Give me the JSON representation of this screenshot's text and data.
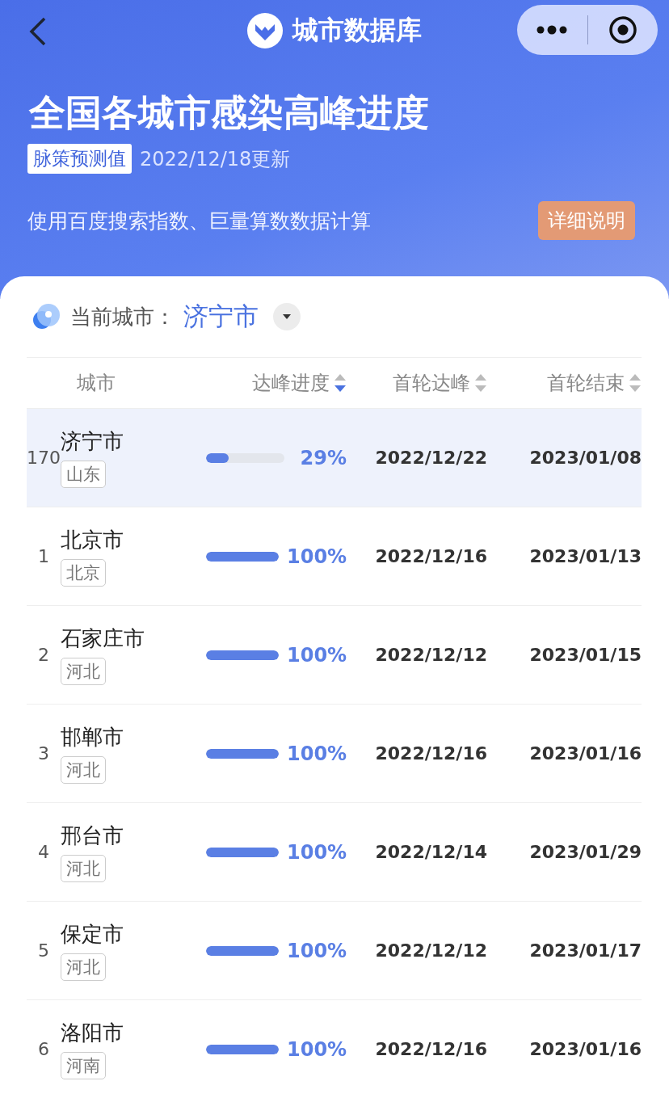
{
  "nav": {
    "title": "城市数据库"
  },
  "header": {
    "title": "全国各城市感染高峰进度",
    "badge": "脉策预测值",
    "updated": "2022/12/18更新",
    "description": "使用百度搜索指数、巨量算数数据计算",
    "detail_button": "详细说明"
  },
  "current_city": {
    "label": "当前城市：",
    "value": "济宁市"
  },
  "table": {
    "columns": [
      {
        "label": "城市",
        "sortable": false
      },
      {
        "label": "达峰进度",
        "sortable": true,
        "sorted_desc": true
      },
      {
        "label": "首轮达峰",
        "sortable": true,
        "sorted_desc": false
      },
      {
        "label": "首轮结束",
        "sortable": true,
        "sorted_desc": false
      }
    ],
    "rows": [
      {
        "rank": "170",
        "city": "济宁市",
        "province": "山东",
        "level": 0.29,
        "percent": "29%",
        "peak": "2022/12/22",
        "end": "2023/01/08",
        "selected": true
      },
      {
        "rank": "1",
        "city": "北京市",
        "province": "北京",
        "level": 1,
        "percent": "100%",
        "peak": "2022/12/16",
        "end": "2023/01/13",
        "selected": false
      },
      {
        "rank": "2",
        "city": "石家庄市",
        "province": "河北",
        "level": 1,
        "percent": "100%",
        "peak": "2022/12/12",
        "end": "2023/01/15",
        "selected": false
      },
      {
        "rank": "3",
        "city": "邯郸市",
        "province": "河北",
        "level": 1,
        "percent": "100%",
        "peak": "2022/12/16",
        "end": "2023/01/16",
        "selected": false
      },
      {
        "rank": "4",
        "city": "邢台市",
        "province": "河北",
        "level": 1,
        "percent": "100%",
        "peak": "2022/12/14",
        "end": "2023/01/29",
        "selected": false
      },
      {
        "rank": "5",
        "city": "保定市",
        "province": "河北",
        "level": 1,
        "percent": "100%",
        "peak": "2022/12/12",
        "end": "2023/01/17",
        "selected": false
      },
      {
        "rank": "6",
        "city": "洛阳市",
        "province": "河南",
        "level": 1,
        "percent": "100%",
        "peak": "2022/12/16",
        "end": "2023/01/16",
        "selected": false
      }
    ]
  }
}
